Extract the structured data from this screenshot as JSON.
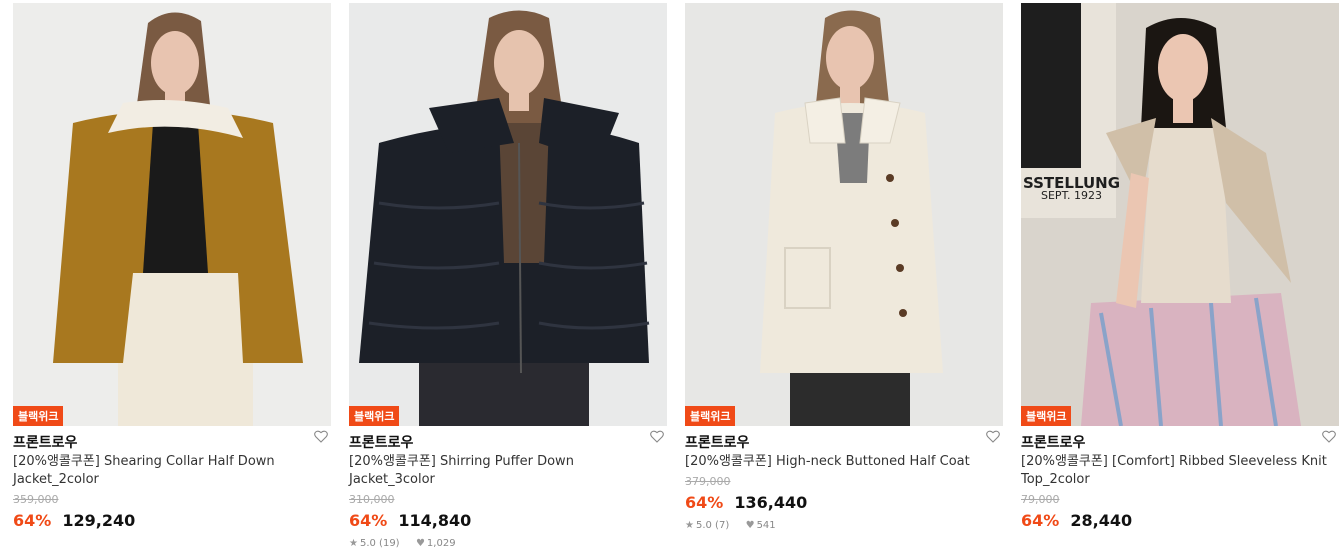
{
  "products": [
    {
      "badge": "블랙위크",
      "brand": "프론트로우",
      "title": "[20%앵콜쿠폰] Shearing Collar Half Down Jacket_2color",
      "original_price": "359,000",
      "discount": "64%",
      "price": "129,240",
      "rating": "",
      "likes": "",
      "image_icon": "product-photo-mustard-down-jacket",
      "colors": {
        "bg": "#ededeb",
        "garment": "#a8781f",
        "inner": "#1a1a1a",
        "bottom": "#efe8d9",
        "collar": "#f2ede3",
        "skin": "#e8c4b0",
        "hair": "#7a5a42"
      }
    },
    {
      "badge": "블랙위크",
      "brand": "프론트로우",
      "title": "[20%앵콜쿠폰] Shirring Puffer Down Jacket_3color",
      "original_price": "310,000",
      "discount": "64%",
      "price": "114,840",
      "rating": "5.0 (19)",
      "likes": "1,029",
      "image_icon": "product-photo-black-puffer-jacket",
      "colors": {
        "bg": "#e9eaea",
        "garment": "#1c2028",
        "inner": "#5a4536",
        "bottom": "#2a2a30",
        "collar": "#1c2028",
        "skin": "#e6c3ae",
        "hair": "#7a5a42"
      }
    },
    {
      "badge": "블랙위크",
      "brand": "프론트로우",
      "title": "[20%앵콜쿠폰] High-neck Buttoned Half Coat",
      "original_price": "379,000",
      "discount": "64%",
      "price": "136,440",
      "rating": "5.0 (7)",
      "likes": "541",
      "image_icon": "product-photo-ivory-half-coat",
      "colors": {
        "bg": "#e7e7e5",
        "garment": "#efe9dc",
        "inner": "#7c7c7c",
        "bottom": "#2c2c2c",
        "collar": "#efe9dc",
        "skin": "#e8c4b0",
        "hair": "#8a6a4e"
      }
    },
    {
      "badge": "블랙위크",
      "brand": "프론트로우",
      "title": "[20%앵콜쿠폰] [Comfort] Ribbed Sleeveless Knit Top_2color",
      "original_price": "79,000",
      "discount": "64%",
      "price": "28,440",
      "rating": "",
      "likes": "",
      "image_icon": "product-photo-ribbed-knit-top",
      "poster_text": "SSTELLUNG",
      "poster_subtext": "SEPT. 1923",
      "colors": {
        "bg": "#d9d4cc",
        "garment": "#e6dccd",
        "inner": "#e6dccd",
        "bottom": "#d9b3c0",
        "collar": "#d0bfa8",
        "skin": "#ebc6b2",
        "hair": "#1b1612"
      }
    }
  ],
  "accent_color": "#f04a17"
}
